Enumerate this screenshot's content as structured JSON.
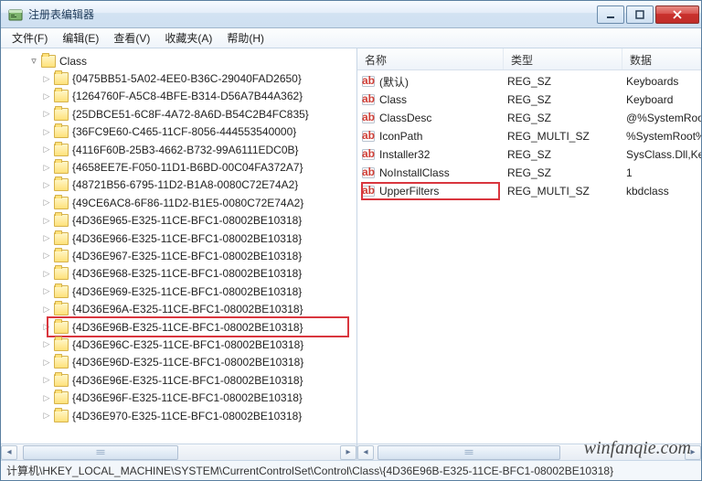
{
  "window": {
    "title": "注册表编辑器"
  },
  "menu": {
    "file": "文件(F)",
    "edit": "编辑(E)",
    "view": "查看(V)",
    "favorites": "收藏夹(A)",
    "help": "帮助(H)"
  },
  "tree": {
    "root": "Class",
    "items": [
      "{0475BB51-5A02-4EE0-B36C-29040FAD2650}",
      "{1264760F-A5C8-4BFE-B314-D56A7B44A362}",
      "{25DBCE51-6C8F-4A72-8A6D-B54C2B4FC835}",
      "{36FC9E60-C465-11CF-8056-444553540000}",
      "{4116F60B-25B3-4662-B732-99A6111EDC0B}",
      "{4658EE7E-F050-11D1-B6BD-00C04FA372A7}",
      "{48721B56-6795-11D2-B1A8-0080C72E74A2}",
      "{49CE6AC8-6F86-11D2-B1E5-0080C72E74A2}",
      "{4D36E965-E325-11CE-BFC1-08002BE10318}",
      "{4D36E966-E325-11CE-BFC1-08002BE10318}",
      "{4D36E967-E325-11CE-BFC1-08002BE10318}",
      "{4D36E968-E325-11CE-BFC1-08002BE10318}",
      "{4D36E969-E325-11CE-BFC1-08002BE10318}",
      "{4D36E96A-E325-11CE-BFC1-08002BE10318}",
      "{4D36E96B-E325-11CE-BFC1-08002BE10318}",
      "{4D36E96C-E325-11CE-BFC1-08002BE10318}",
      "{4D36E96D-E325-11CE-BFC1-08002BE10318}",
      "{4D36E96E-E325-11CE-BFC1-08002BE10318}",
      "{4D36E96F-E325-11CE-BFC1-08002BE10318}",
      "{4D36E970-E325-11CE-BFC1-08002BE10318}"
    ],
    "highlight_index": 14
  },
  "columns": {
    "name": "名称",
    "type": "类型",
    "data": "数据"
  },
  "values": [
    {
      "name": "(默认)",
      "type": "REG_SZ",
      "data": "Keyboards",
      "hl": false
    },
    {
      "name": "Class",
      "type": "REG_SZ",
      "data": "Keyboard",
      "hl": false
    },
    {
      "name": "ClassDesc",
      "type": "REG_SZ",
      "data": "@%SystemRoot",
      "hl": false
    },
    {
      "name": "IconPath",
      "type": "REG_MULTI_SZ",
      "data": "%SystemRoot%",
      "hl": false
    },
    {
      "name": "Installer32",
      "type": "REG_SZ",
      "data": "SysClass.Dll,Ke",
      "hl": false
    },
    {
      "name": "NoInstallClass",
      "type": "REG_SZ",
      "data": "1",
      "hl": false
    },
    {
      "name": "UpperFilters",
      "type": "REG_MULTI_SZ",
      "data": "kbdclass",
      "hl": true
    }
  ],
  "status": {
    "prefix": "计算机",
    "path": "\\HKEY_LOCAL_MACHINE\\SYSTEM\\CurrentControlSet\\Control\\Class\\{4D36E96B-E325-11CE-BFC1-08002BE10318}"
  },
  "watermark": "winfanqie.com"
}
